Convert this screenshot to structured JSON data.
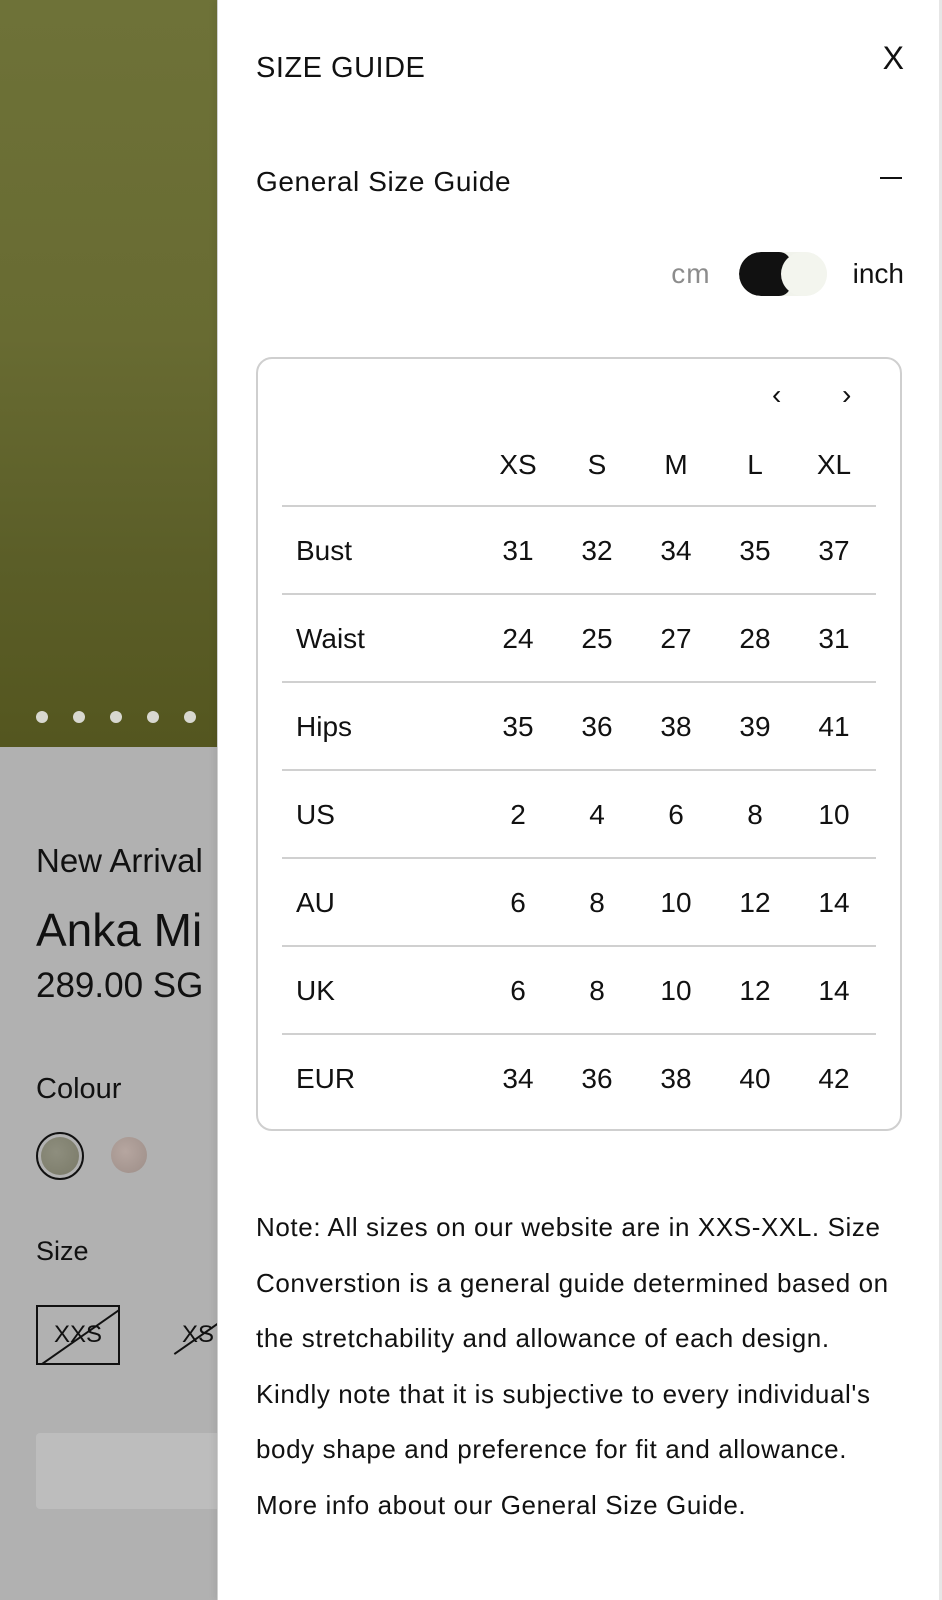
{
  "product": {
    "tag": "New Arrival",
    "name": "Anka Mi",
    "price": "289.00 SG",
    "colour_label": "Colour",
    "size_label": "Size",
    "sizes": [
      "XXS",
      "XS"
    ],
    "carousel_dots": 5
  },
  "drawer": {
    "title": "SIZE GUIDE",
    "close_label": "X",
    "section_title": "General Size Guide",
    "units": {
      "cm": "cm",
      "inch": "inch",
      "selected": "inch"
    },
    "nav": {
      "prev": "‹",
      "next": "›"
    },
    "table": {
      "columns": [
        "XS",
        "S",
        "M",
        "L",
        "XL"
      ],
      "rows": [
        {
          "label": "Bust",
          "values": [
            "31",
            "32",
            "34",
            "35",
            "37"
          ]
        },
        {
          "label": "Waist",
          "values": [
            "24",
            "25",
            "27",
            "28",
            "31"
          ]
        },
        {
          "label": "Hips",
          "values": [
            "35",
            "36",
            "38",
            "39",
            "41"
          ]
        },
        {
          "label": "US",
          "values": [
            "2",
            "4",
            "6",
            "8",
            "10"
          ]
        },
        {
          "label": "AU",
          "values": [
            "6",
            "8",
            "10",
            "12",
            "14"
          ]
        },
        {
          "label": "UK",
          "values": [
            "6",
            "8",
            "10",
            "12",
            "14"
          ]
        },
        {
          "label": "EUR",
          "values": [
            "34",
            "36",
            "38",
            "40",
            "42"
          ]
        }
      ]
    },
    "note": "Note: All sizes on our website are in XXS-XXL. Size Converstion is a general guide determined based on the stretchability and allowance of each design. Kindly note that it is subjective to every individual's body shape and preference for fit and allowance. More info about our General Size Guide."
  }
}
